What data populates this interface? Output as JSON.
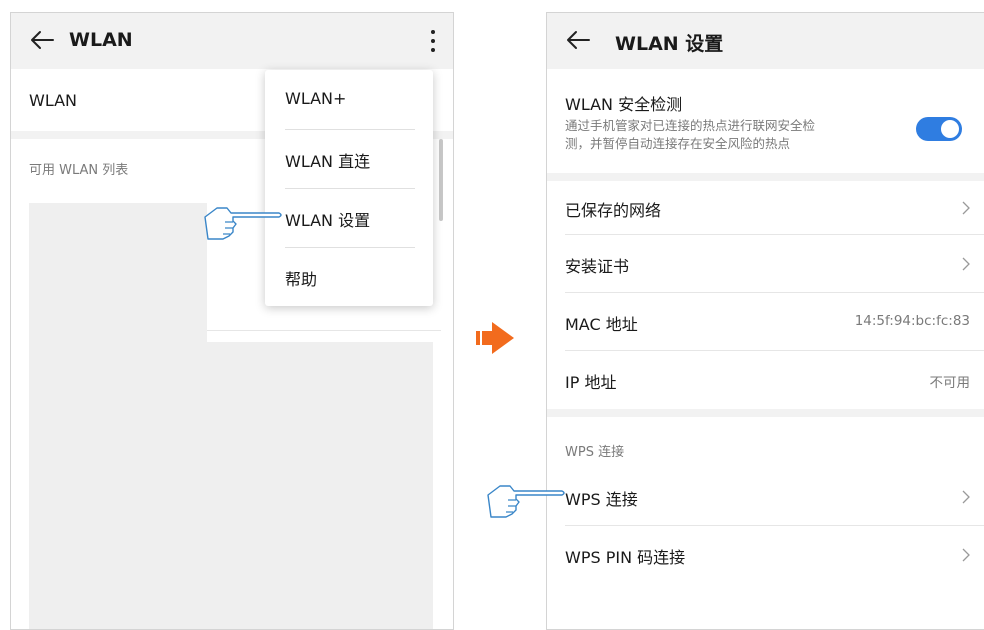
{
  "left_screen": {
    "title": "WLAN",
    "wlan_row_label": "WLAN",
    "available_list_label": "可用 WLAN 列表",
    "menu_items": [
      {
        "label": "WLAN+"
      },
      {
        "label": "WLAN 直连"
      },
      {
        "label": "WLAN 设置"
      },
      {
        "label": "帮助"
      }
    ]
  },
  "right_screen": {
    "title": "WLAN 设置",
    "security_check": {
      "label": "WLAN 安全检测",
      "description_line1": "通过手机管家对已连接的热点进行联网安全检",
      "description_line2": "测，并暂停自动连接存在安全风险的热点",
      "toggle_on": true
    },
    "saved_networks_label": "已保存的网络",
    "install_cert_label": "安装证书",
    "mac_label": "MAC 地址",
    "mac_value": "14:5f:94:bc:fc:83",
    "ip_label": "IP 地址",
    "ip_value": "不可用",
    "wps_section_label": "WPS 连接",
    "wps_connect_label": "WPS 连接",
    "wps_pin_label": "WPS PIN 码连接"
  },
  "colors": {
    "toggle_blue": "#2f7de1",
    "arrow_orange": "#f26b1d"
  },
  "icons": [
    "back-arrow-icon",
    "more-vert-icon",
    "pointing-hand-icon",
    "chevron-right-icon",
    "right-arrow-icon"
  ]
}
